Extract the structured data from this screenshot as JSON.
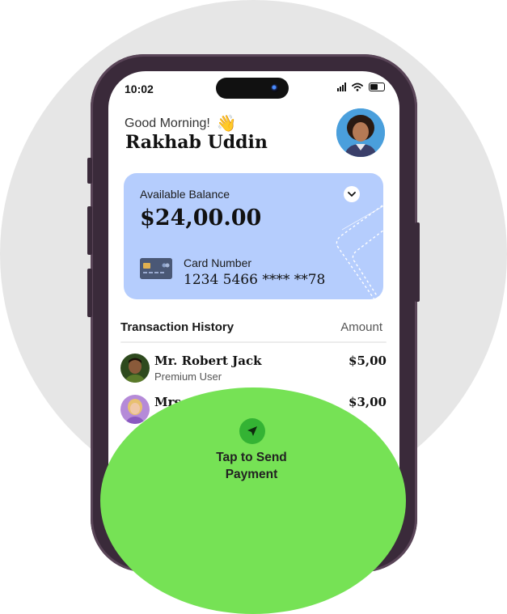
{
  "status_bar": {
    "time": "10:02"
  },
  "header": {
    "greeting": "Good Morning!",
    "wave_emoji": "👋",
    "name": "Rakhab Uddin"
  },
  "balance_card": {
    "label": "Available Balance",
    "balance": "$24,00.00",
    "card_number_label": "Card Number",
    "card_number": "1234 5466 **** **78",
    "color": "#b5cdfd"
  },
  "transactions": {
    "title": "Transaction History",
    "amount_header": "Amount",
    "items": [
      {
        "name": "Mr. Robert Jack",
        "subtitle": "Premium User",
        "amount": "$5,00"
      },
      {
        "name": "Mrs.",
        "subtitle": "",
        "amount": "$3,00"
      }
    ]
  },
  "send_payment": {
    "label_line1": "Tap to Send",
    "label_line2": "Payment",
    "icon": "send-arrow-icon",
    "color": "#76e255"
  }
}
